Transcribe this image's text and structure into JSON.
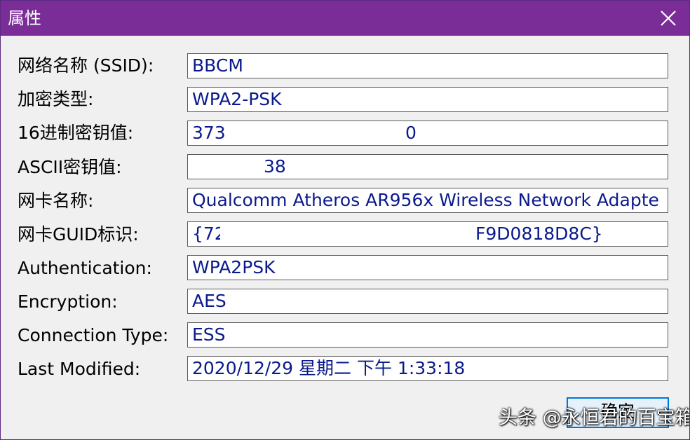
{
  "window": {
    "title": "属性",
    "title_bar_color": "#7a2d96",
    "close_icon": "close-icon"
  },
  "fields": {
    "ssid": {
      "label": "网络名称 (SSID):",
      "value": "BBCM"
    },
    "encryption_type": {
      "label": "加密类型:",
      "value": "WPA2-PSK"
    },
    "hex_key": {
      "label": "16进制密钥值:",
      "value": "373",
      "value_tail": "0"
    },
    "ascii_key": {
      "label": "ASCII密钥值:",
      "value": "",
      "value_tail": "38"
    },
    "adapter_name": {
      "label": "网卡名称:",
      "value": "Qualcomm Atheros AR956x Wireless Network Adapte"
    },
    "adapter_guid": {
      "label": "网卡GUID标识:",
      "value": "{72",
      "value_tail": "F9D0818D8C}"
    },
    "authentication": {
      "label": "Authentication:",
      "value": "WPA2PSK"
    },
    "encryption": {
      "label": "Encryption:",
      "value": "AES"
    },
    "connection_type": {
      "label": "Connection Type:",
      "value": "ESS"
    },
    "last_modified": {
      "label": "Last Modified:",
      "value": "2020/12/29 星期二 下午 1:33:18"
    }
  },
  "buttons": {
    "ok_label": "确定"
  },
  "watermark": "头条 @永恒君的百宝箱"
}
